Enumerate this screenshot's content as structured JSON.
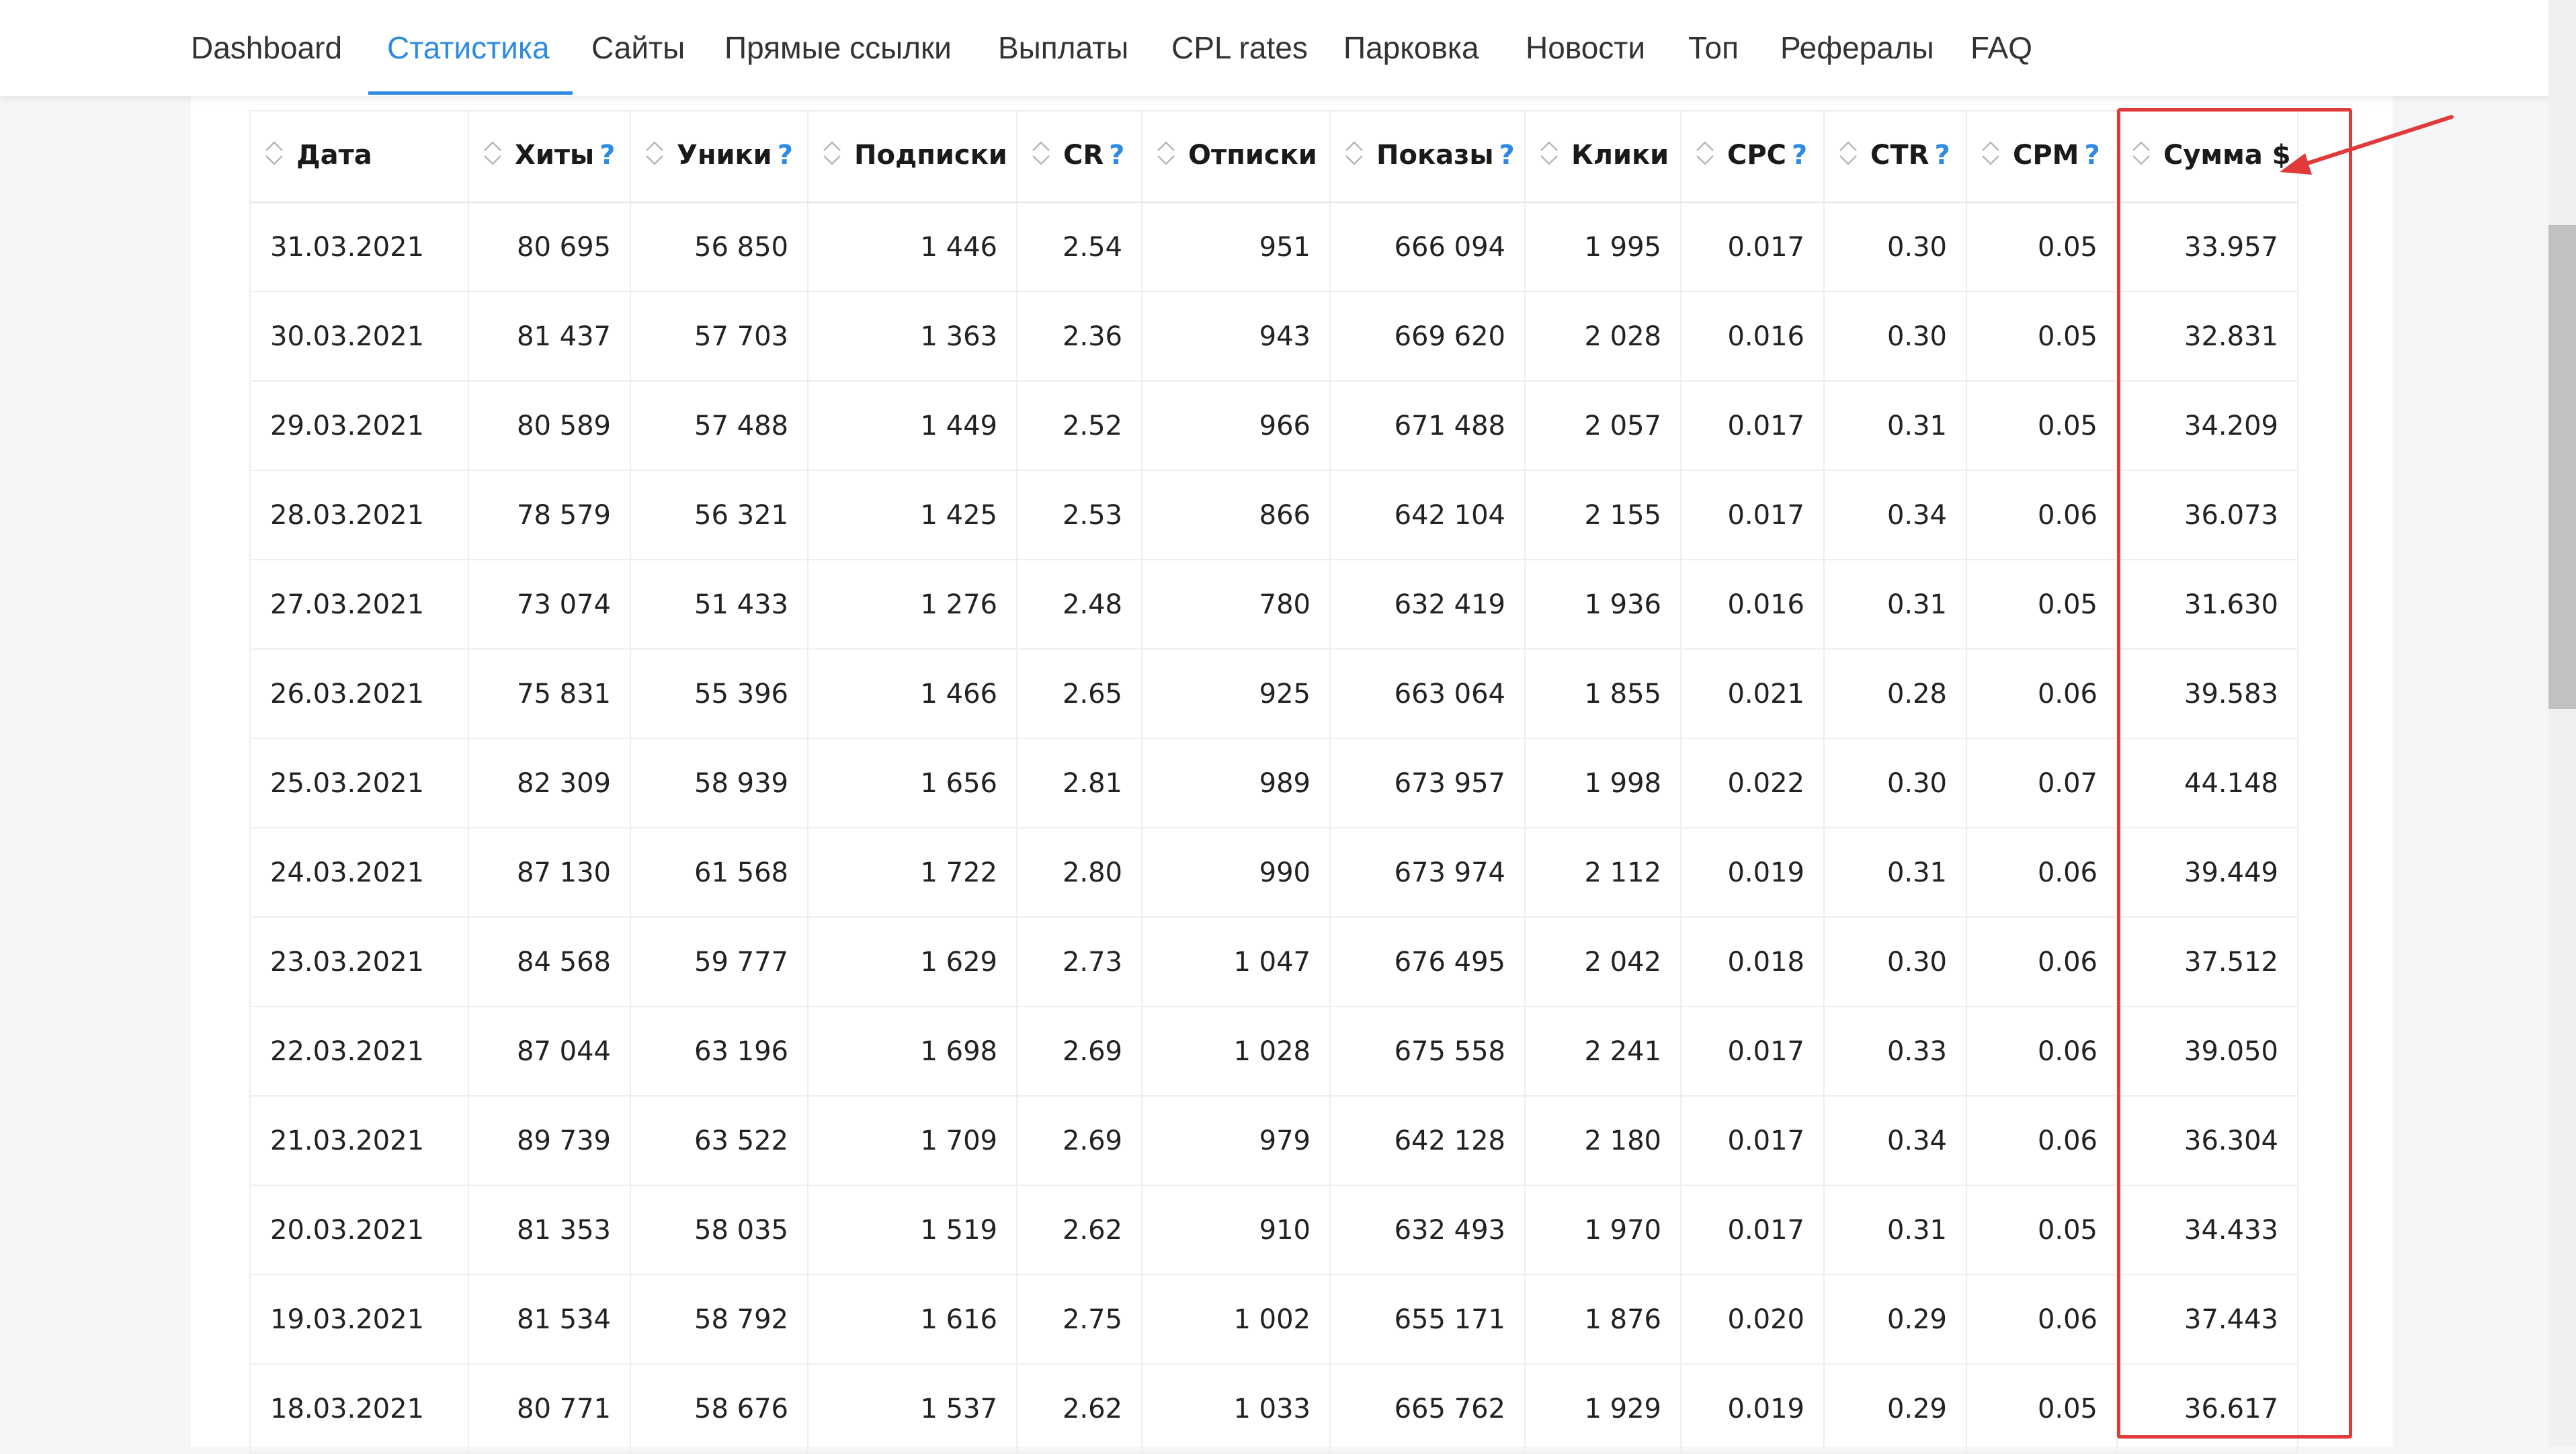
{
  "nav": {
    "items": [
      {
        "label": "Dashboard",
        "active": false
      },
      {
        "label": "Статистика",
        "active": true
      },
      {
        "label": "Сайты",
        "active": false
      },
      {
        "label": "Прямые ссылки",
        "active": false
      },
      {
        "label": "Выплаты",
        "active": false
      },
      {
        "label": "CPL rates",
        "active": false
      },
      {
        "label": "Парковка",
        "active": false
      },
      {
        "label": "Новости",
        "active": false
      },
      {
        "label": "Топ",
        "active": false
      },
      {
        "label": "Рефералы",
        "active": false
      },
      {
        "label": "FAQ",
        "active": false
      }
    ],
    "accent_color": "#2d8ae5"
  },
  "table": {
    "help_mark": "?",
    "columns": [
      {
        "label": "Дата",
        "help": false
      },
      {
        "label": "Хиты",
        "help": true
      },
      {
        "label": "Уники",
        "help": true
      },
      {
        "label": "Подписки",
        "help": false
      },
      {
        "label": "CR",
        "help": true
      },
      {
        "label": "Отписки",
        "help": false
      },
      {
        "label": "Показы",
        "help": true
      },
      {
        "label": "Клики",
        "help": false
      },
      {
        "label": "CPC",
        "help": true
      },
      {
        "label": "CTR",
        "help": true
      },
      {
        "label": "CPM",
        "help": true
      },
      {
        "label": "Сумма $",
        "help": false
      }
    ],
    "rows": [
      [
        "31.03.2021",
        "80 695",
        "56 850",
        "1 446",
        "2.54",
        "951",
        "666 094",
        "1 995",
        "0.017",
        "0.30",
        "0.05",
        "33.957"
      ],
      [
        "30.03.2021",
        "81 437",
        "57 703",
        "1 363",
        "2.36",
        "943",
        "669 620",
        "2 028",
        "0.016",
        "0.30",
        "0.05",
        "32.831"
      ],
      [
        "29.03.2021",
        "80 589",
        "57 488",
        "1 449",
        "2.52",
        "966",
        "671 488",
        "2 057",
        "0.017",
        "0.31",
        "0.05",
        "34.209"
      ],
      [
        "28.03.2021",
        "78 579",
        "56 321",
        "1 425",
        "2.53",
        "866",
        "642 104",
        "2 155",
        "0.017",
        "0.34",
        "0.06",
        "36.073"
      ],
      [
        "27.03.2021",
        "73 074",
        "51 433",
        "1 276",
        "2.48",
        "780",
        "632 419",
        "1 936",
        "0.016",
        "0.31",
        "0.05",
        "31.630"
      ],
      [
        "26.03.2021",
        "75 831",
        "55 396",
        "1 466",
        "2.65",
        "925",
        "663 064",
        "1 855",
        "0.021",
        "0.28",
        "0.06",
        "39.583"
      ],
      [
        "25.03.2021",
        "82 309",
        "58 939",
        "1 656",
        "2.81",
        "989",
        "673 957",
        "1 998",
        "0.022",
        "0.30",
        "0.07",
        "44.148"
      ],
      [
        "24.03.2021",
        "87 130",
        "61 568",
        "1 722",
        "2.80",
        "990",
        "673 974",
        "2 112",
        "0.019",
        "0.31",
        "0.06",
        "39.449"
      ],
      [
        "23.03.2021",
        "84 568",
        "59 777",
        "1 629",
        "2.73",
        "1 047",
        "676 495",
        "2 042",
        "0.018",
        "0.30",
        "0.06",
        "37.512"
      ],
      [
        "22.03.2021",
        "87 044",
        "63 196",
        "1 698",
        "2.69",
        "1 028",
        "675 558",
        "2 241",
        "0.017",
        "0.33",
        "0.06",
        "39.050"
      ],
      [
        "21.03.2021",
        "89 739",
        "63 522",
        "1 709",
        "2.69",
        "979",
        "642 128",
        "2 180",
        "0.017",
        "0.34",
        "0.06",
        "36.304"
      ],
      [
        "20.03.2021",
        "81 353",
        "58 035",
        "1 519",
        "2.62",
        "910",
        "632 493",
        "1 970",
        "0.017",
        "0.31",
        "0.05",
        "34.433"
      ],
      [
        "19.03.2021",
        "81 534",
        "58 792",
        "1 616",
        "2.75",
        "1 002",
        "655 171",
        "1 876",
        "0.020",
        "0.29",
        "0.06",
        "37.443"
      ],
      [
        "18.03.2021",
        "80 771",
        "58 676",
        "1 537",
        "2.62",
        "1 033",
        "665 762",
        "1 929",
        "0.019",
        "0.29",
        "0.05",
        "36.617"
      ]
    ]
  },
  "annotation": {
    "highlight_color": "#e03a3a",
    "icon": "red-arrow-icon"
  }
}
